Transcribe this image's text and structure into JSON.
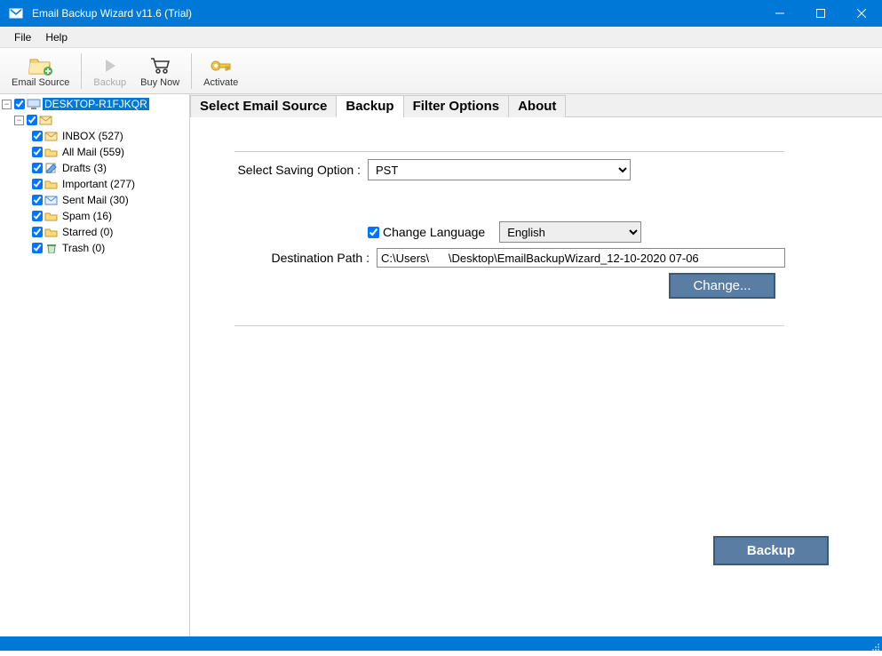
{
  "window": {
    "title": "Email Backup Wizard v11.6 (Trial)"
  },
  "menu": {
    "file": "File",
    "help": "Help"
  },
  "toolbar": {
    "email_source": "Email Source",
    "backup": "Backup",
    "buy_now": "Buy Now",
    "activate": "Activate"
  },
  "tree": {
    "root": "DESKTOP-R1FJKQR",
    "account": "",
    "folders": [
      {
        "label": "INBOX (527)"
      },
      {
        "label": "All Mail (559)"
      },
      {
        "label": "Drafts (3)"
      },
      {
        "label": "Important (277)"
      },
      {
        "label": "Sent Mail (30)"
      },
      {
        "label": "Spam (16)"
      },
      {
        "label": "Starred (0)"
      },
      {
        "label": "Trash (0)"
      }
    ]
  },
  "tabs": {
    "select_source": "Select Email Source",
    "backup": "Backup",
    "filter": "Filter Options",
    "about": "About"
  },
  "backup_panel": {
    "saving_option_label": "Select Saving Option :",
    "saving_option_value": "PST",
    "change_language_label": "Change Language",
    "language_value": "English",
    "destination_label": "Destination Path :",
    "destination_value": "C:\\Users\\      \\Desktop\\EmailBackupWizard_12-10-2020 07-06",
    "change_button": "Change...",
    "backup_button": "Backup"
  }
}
